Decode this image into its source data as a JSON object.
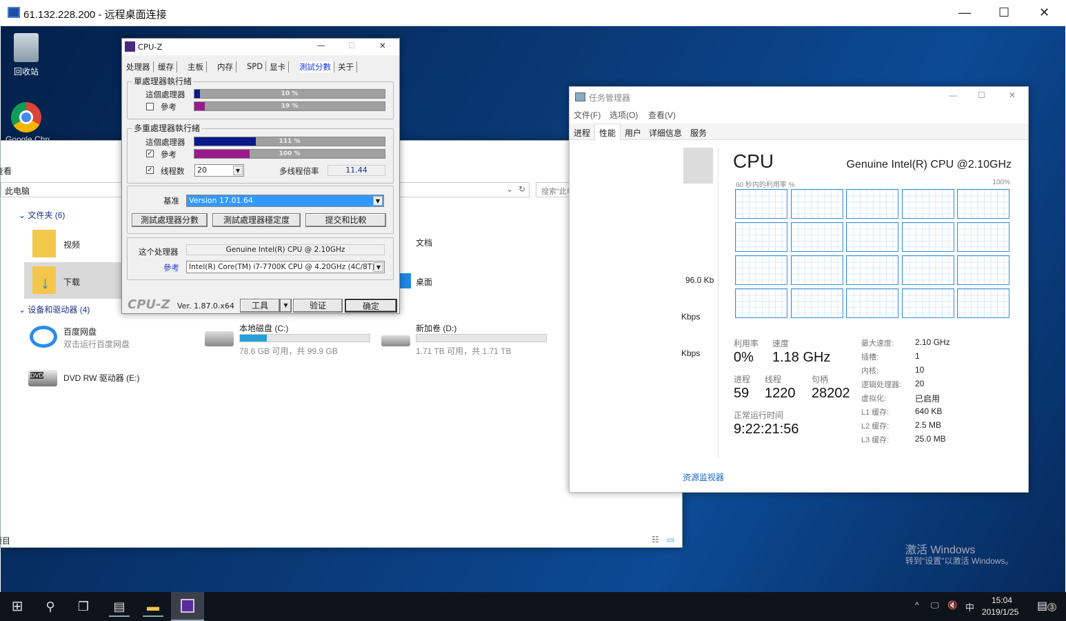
{
  "rdp": {
    "title": "61.132.228.200 - 远程桌面连接"
  },
  "desktop": {
    "recycle_bin": "回收站",
    "chrome": "Google Chrome",
    "activate_title": "激活 Windows",
    "activate_sub": "转到\"设置\"以激活 Windows。"
  },
  "taskbar": {
    "time": "15:04",
    "date": "2019/1/25",
    "ime": "中",
    "notifications": "3"
  },
  "explorer": {
    "view_menu": "查看",
    "address": "此电脑",
    "search_placeholder": "搜索\"此电脑\"",
    "folders_header": "文件夹 (6)",
    "folders": [
      "视频",
      "下载",
      "文档",
      "桌面"
    ],
    "devices_header": "设备和驱动器 (4)",
    "baidu": {
      "name": "百度网盘",
      "sub": "双击运行百度网盘"
    },
    "drive_c": {
      "name": "本地磁盘 (C:)",
      "info": "78.6 GB 可用，共 99.9 GB",
      "used_fraction": 0.21
    },
    "drive_d": {
      "name": "新加卷 (D:)",
      "info": "1.71 TB 可用，共 1.71 TB",
      "used_fraction": 0.0
    },
    "dvd": {
      "name": "DVD RW 驱动器 (E:)"
    },
    "status": "项目"
  },
  "taskmgr": {
    "title": "任务管理器",
    "menu": [
      "文件(F)",
      "选项(O)",
      "查看(V)"
    ],
    "tabs": [
      "进程",
      "性能",
      "用户",
      "详细信息",
      "服务"
    ],
    "left_values": [
      "96.0 Kb",
      "Kbps",
      "Kbps"
    ],
    "resource_monitor": "资源监视器",
    "cpu_title": "CPU",
    "cpu_name": "Genuine Intel(R) CPU @2.10GHz",
    "graph_label": "60 秒内的利用率 %",
    "graph_max": "100%",
    "stats": {
      "util_label": "利用率",
      "util": "0%",
      "speed_label": "速度",
      "speed": "1.18 GHz",
      "proc_label": "进程",
      "proc": "59",
      "thread_label": "线程",
      "thread": "1220",
      "handle_label": "句柄",
      "handle": "28202",
      "uptime_label": "正常运行时间",
      "uptime": "9:22:21:56"
    },
    "specs": [
      [
        "最大速度:",
        "2.10 GHz"
      ],
      [
        "插槽:",
        "1"
      ],
      [
        "内核:",
        "10"
      ],
      [
        "逻辑处理器:",
        "20"
      ],
      [
        "虚拟化:",
        "已启用"
      ],
      [
        "L1 缓存:",
        "640 KB"
      ],
      [
        "L2 缓存:",
        "2.5 MB"
      ],
      [
        "L3 缓存:",
        "25.0 MB"
      ]
    ]
  },
  "cpuz": {
    "title": "CPU-Z",
    "tabs": [
      "处理器",
      "缓存",
      "主板",
      "内存",
      "SPD",
      "显卡",
      "測試分數",
      "关于"
    ],
    "single_title": "單處理器執行緒",
    "multi_title": "多重處理器執行緒",
    "this_cpu": "這個處理器",
    "ref": "參考",
    "single_this": {
      "label": "10 %",
      "value": 10
    },
    "single_ref": {
      "label": "19 %",
      "value": 19
    },
    "multi_this": {
      "label": "111 %",
      "value": 111
    },
    "multi_ref": {
      "label": "100 %",
      "value": 100
    },
    "threads_label": "线程数",
    "threads": "20",
    "ratio_label": "多线程倍率",
    "ratio": "11.44",
    "baseline_label": "基准",
    "baseline": "Version 17.01.64",
    "buttons": [
      "測試處理器分數",
      "測試處理器穩定度",
      "提交和比較"
    ],
    "this_proc_label": "这个处理器",
    "this_proc": "Genuine Intel(R) CPU  @ 2.10GHz",
    "ref_label": "參考",
    "ref_proc": "Intel(R) Core(TM) i7-7700K CPU @ 4.20GHz (4C/8T)",
    "brand": "CPU-Z",
    "version": "Ver. 1.87.0.x64",
    "tools": "工具",
    "validate": "验证",
    "ok": "确定"
  }
}
